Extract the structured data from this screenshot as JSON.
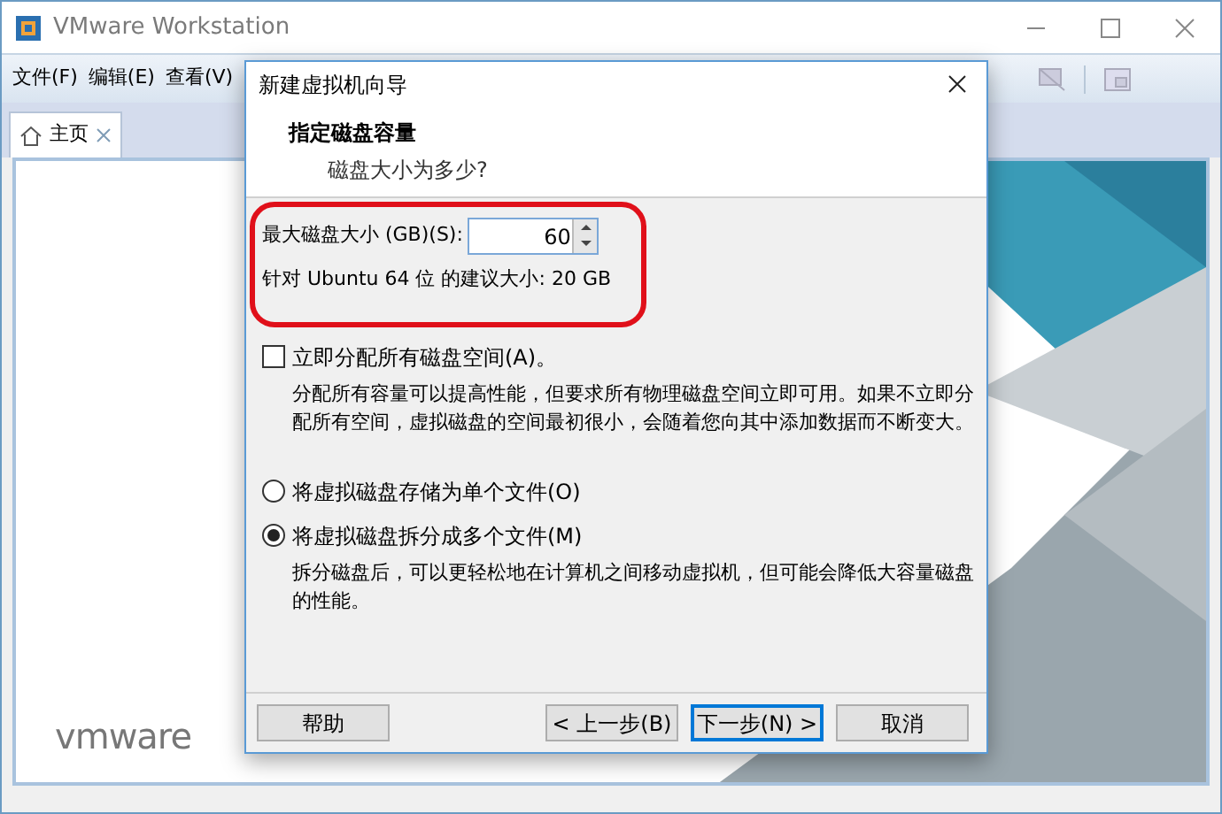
{
  "window": {
    "title": "VMware Workstation"
  },
  "menu": [
    "文件(F)",
    "编辑(E)",
    "查看(V)"
  ],
  "tabs": [
    {
      "label": "主页",
      "selected": true
    }
  ],
  "logo": "vmware",
  "dialog": {
    "title": "新建虚拟机向导",
    "heading": "指定磁盘容量",
    "subtitle": "磁盘大小为多少?",
    "size_label": "最大磁盘大小 (GB)(S):",
    "size_value": "60",
    "recommended": "针对 Ubuntu 64 位 的建议大小: 20 GB",
    "allocate": {
      "label": "立即分配所有磁盘空间(A)。",
      "checked": false
    },
    "allocate_note": "分配所有容量可以提高性能，但要求所有物理磁盘空间立即可用。如果不立即分配所有空间，虚拟磁盘的空间最初很小，会随着您向其中添加数据而不断变大。",
    "storage_options": [
      {
        "label": "将虚拟磁盘存储为单个文件(O)",
        "selected": false
      },
      {
        "label": "将虚拟磁盘拆分成多个文件(M)",
        "selected": true
      }
    ],
    "split_note": "拆分磁盘后，可以更轻松地在计算机之间移动虚拟机，但可能会降低大容量磁盘的性能。",
    "buttons": [
      {
        "label": "帮助",
        "default": false
      },
      {
        "label": "< 上一步(B)",
        "default": false
      },
      {
        "label": "下一步(N) >",
        "default": true
      },
      {
        "label": "取消",
        "default": false
      }
    ]
  }
}
